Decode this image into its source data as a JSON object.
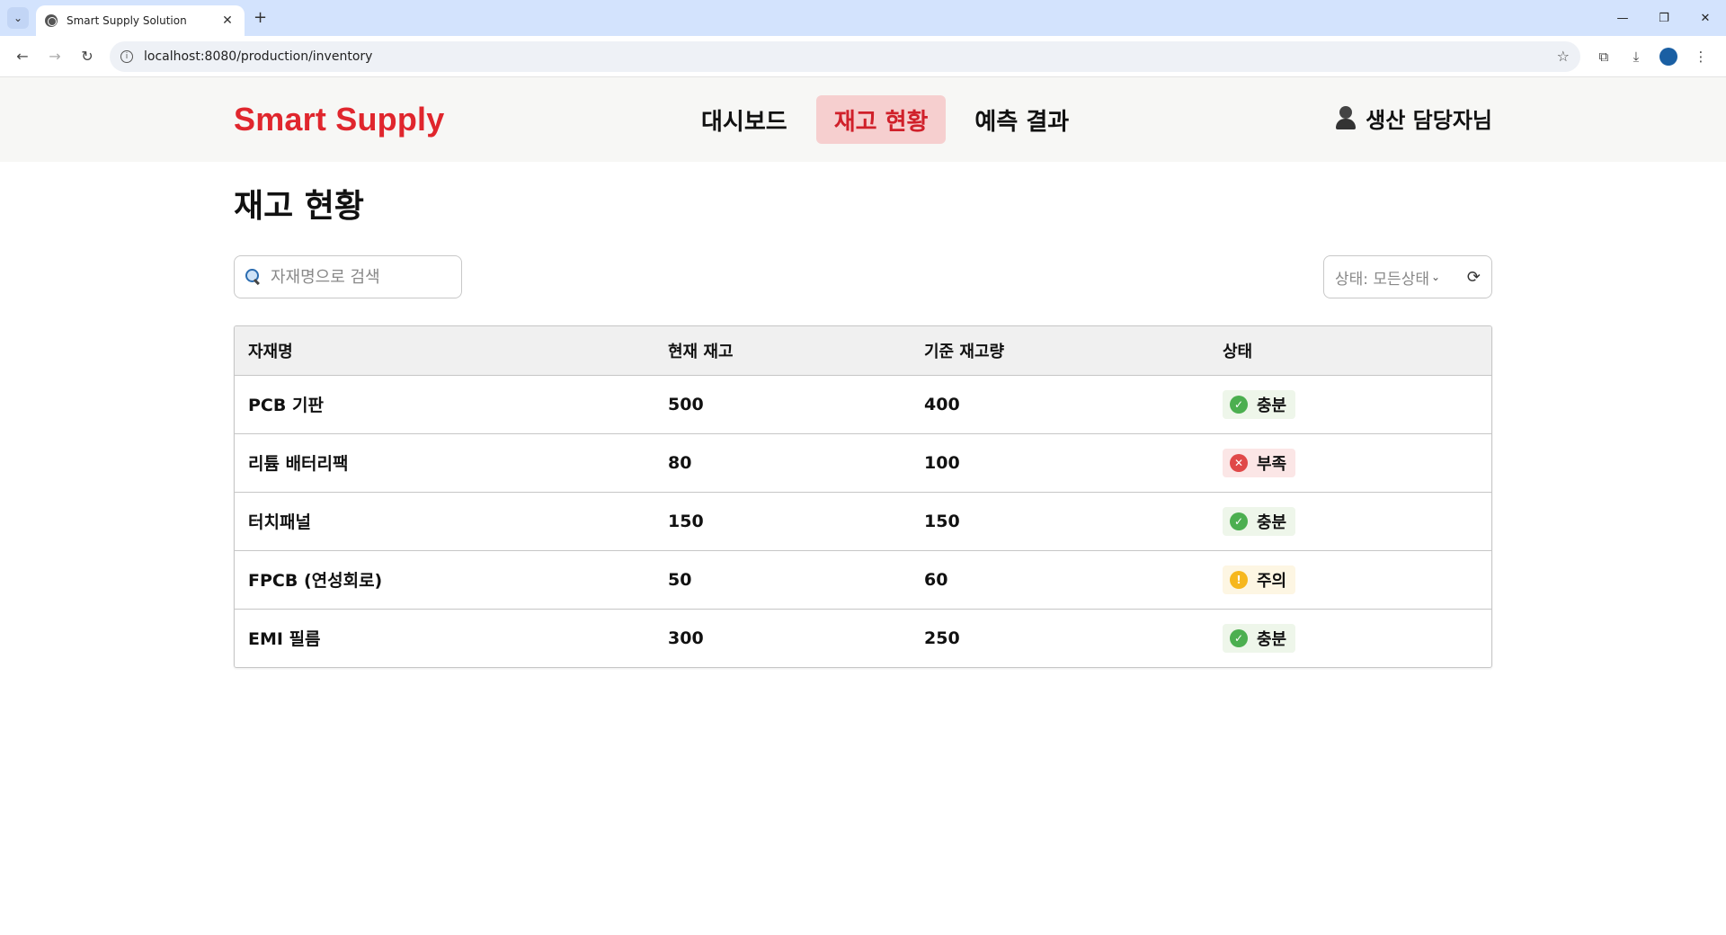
{
  "browser": {
    "tab_title": "Smart Supply Solution",
    "url": "localhost:8080/production/inventory"
  },
  "header": {
    "brand": "Smart Supply",
    "nav": [
      {
        "label": "대시보드",
        "active": false
      },
      {
        "label": "재고 현황",
        "active": true
      },
      {
        "label": "예측 결과",
        "active": false
      }
    ],
    "user_label": "생산 담당자님"
  },
  "page": {
    "title": "재고 현황",
    "search_placeholder": "자재명으로 검색",
    "filter_label": "상태: 모든상태"
  },
  "table": {
    "columns": [
      "자재명",
      "현재 재고",
      "기준 재고량",
      "상태"
    ],
    "rows": [
      {
        "name": "PCB 기판",
        "current": "500",
        "base": "400",
        "status": "충분",
        "status_type": "ok"
      },
      {
        "name": "리튬 배터리팩",
        "current": "80",
        "base": "100",
        "status": "부족",
        "status_type": "low"
      },
      {
        "name": "터치패널",
        "current": "150",
        "base": "150",
        "status": "충분",
        "status_type": "ok"
      },
      {
        "name": "FPCB (연성회로)",
        "current": "50",
        "base": "60",
        "status": "주의",
        "status_type": "warn"
      },
      {
        "name": "EMI 필름",
        "current": "300",
        "base": "250",
        "status": "충분",
        "status_type": "ok"
      }
    ]
  },
  "colors": {
    "brand": "#e0262d",
    "active_nav_bg": "#f6cfcf",
    "status_ok": "#4caf50",
    "status_low": "#e04848",
    "status_warn": "#f6b71e"
  }
}
